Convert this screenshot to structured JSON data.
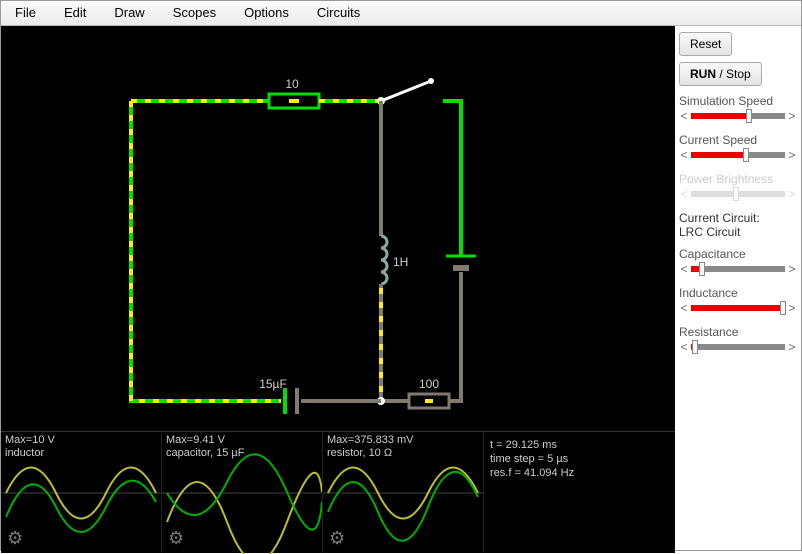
{
  "menu": {
    "items": [
      "File",
      "Edit",
      "Draw",
      "Scopes",
      "Options",
      "Circuits"
    ]
  },
  "circuit": {
    "resistor_top_label": "10",
    "inductor_label": "1H",
    "capacitor_label": "15µF",
    "resistor_bottom_label": "100"
  },
  "scopes": [
    {
      "line1": "Max=10 V",
      "line2": "inductor"
    },
    {
      "line1": "Max=9.41 V",
      "line2": "capacitor, 15 µF"
    },
    {
      "line1": "Max=375.833 mV",
      "line2": "resistor, 10 Ω"
    }
  ],
  "time_info": {
    "t": "t = 29.125 ms",
    "step": "time step = 5 µs",
    "resf": "res.f = 41.094 Hz"
  },
  "sidebar": {
    "reset_label": "Reset",
    "run_bold": "RUN",
    "run_rest": " / Stop",
    "sim_speed_label": "Simulation Speed",
    "current_speed_label": "Current Speed",
    "power_brightness_label": "Power Brightness",
    "current_circuit_label": "Current Circuit:",
    "current_circuit_name": "LRC Circuit",
    "capacitance_label": "Capacitance",
    "inductance_label": "Inductance",
    "resistance_label": "Resistance",
    "sliders": {
      "sim_speed": 62,
      "current_speed": 58,
      "power_brightness": 48,
      "capacitance": 12,
      "inductance": 98,
      "resistance": 4
    }
  }
}
